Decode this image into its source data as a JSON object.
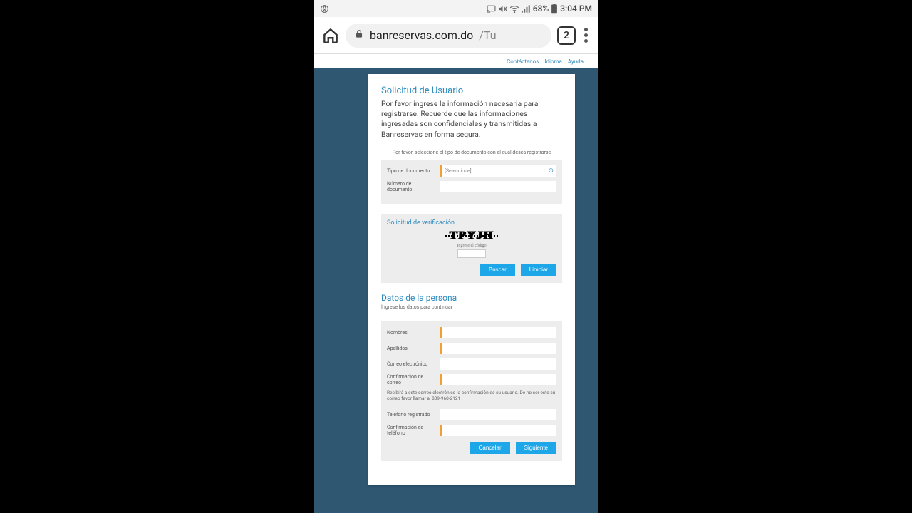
{
  "status": {
    "battery": "68%",
    "time": "3:04 PM"
  },
  "browser": {
    "url_domain": "banreservas.com.do",
    "url_path": "/Tu",
    "tab_count": "2"
  },
  "toplinks": {
    "contact": "Contáctenos",
    "language": "Idioma",
    "help": "Ayuda"
  },
  "form": {
    "title": "Solicitud de Usuario",
    "intro": "Por favor ingrese la información necesaria para registrarse. Recuerde que las informaciones ingresadas son confidenciales y transmitidas a Banreservas en forma segura.",
    "doc_hint": "Por favor, seleccione el tipo de documento con el cual desea registrarse",
    "doc_type_label": "Tipo de documento",
    "doc_type_placeholder": "[Seleccione]",
    "doc_num_label": "Número de documento",
    "verify_title": "Solicitud de verificación",
    "captcha_text": "TPYJH",
    "captcha_hint": "Ingrese el código",
    "btn_buscar": "Buscar",
    "btn_limpiar": "Limpiar",
    "person_title": "Datos de la persona",
    "person_sub": "Ingrese los datos para continuar",
    "nombres_label": "Nombres",
    "apellidos_label": "Apellidos",
    "email_label": "Correo electrónico",
    "email_confirm_label": "Confirmación de correo",
    "email_note": "Recibirá a este correo electrónico la confirmación de su usuario. De no ser este su correo favor llamar al 809-960-2121",
    "phone_label": "Teléfono registrado",
    "phone_confirm_label": "Confirmación de teléfono",
    "btn_cancelar": "Cancelar",
    "btn_siguiente": "Siguiente"
  }
}
